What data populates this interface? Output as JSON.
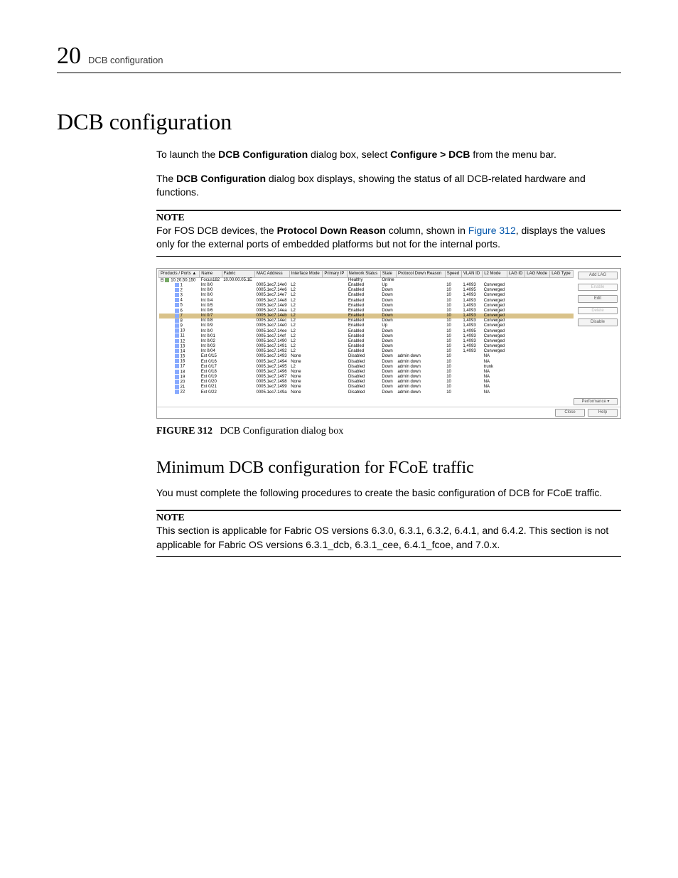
{
  "runningHead": {
    "chapterNumber": "20",
    "chapterLabel": "DCB configuration"
  },
  "title": "DCB configuration",
  "intro": {
    "p1a": "To launch the ",
    "p1b": "DCB Configuration",
    "p1c": " dialog box, select ",
    "p1d": "Configure > DCB",
    "p1e": " from the menu bar.",
    "p2a": "The ",
    "p2b": "DCB Configuration",
    "p2c": " dialog box displays, showing the status of all DCB-related hardware and functions."
  },
  "note1": {
    "heading": "NOTE",
    "a": "For FOS DCB devices, the ",
    "b": "Protocol Down Reason",
    "c": " column, shown in ",
    "link": "Figure 312",
    "d": ", displays the values only for the external ports of embedded platforms but not for the internal ports."
  },
  "figureCaption": {
    "label": "FIGURE 312",
    "text": "DCB Configuration dialog box"
  },
  "subtitle": "Minimum DCB configuration for FCoE traffic",
  "sub_p": "You must complete the following procedures to create the basic configuration of DCB for FCoE traffic.",
  "note2": {
    "heading": "NOTE",
    "text": "This section is applicable for Fabric OS versions 6.3.0, 6.3.1, 6.3.2, 6.4.1, and 6.4.2. This section is not applicable for Fabric OS versions 6.3.1_dcb, 6.3.1_cee, 6.4.1_fcoe, and 7.0.x."
  },
  "screenshot": {
    "buttons": {
      "addLag": "Add LAG",
      "enable": "Enable",
      "edit": "Edit",
      "delete": "Delete",
      "disable": "Disable",
      "performance": "Performance ▾",
      "close": "Close",
      "help": "Help"
    },
    "columns": [
      "Products / Ports ▲",
      "Name",
      "Fabric",
      "MAC Address",
      "Interface Mode",
      "Primary IP",
      "Network Status",
      "State",
      "Protocol Down Reason",
      "Speed",
      "VLAN ID",
      "L2 Mode",
      "LAG ID",
      "LAG Mode",
      "LAG Type"
    ],
    "root": {
      "product": "10.20.50.150",
      "name": "Focus182",
      "fabric": "10.00.00.05.1E",
      "netstatus": "Healthy",
      "state": "Online"
    },
    "rows": [
      {
        "p": "1",
        "name": "Int 0/0",
        "mac": "0005.1ec7.14e0",
        "mode": "L2",
        "ns": "Enabled",
        "st": "Up",
        "sp": "10",
        "vl": "1,4093",
        "l2": "Converged"
      },
      {
        "p": "2",
        "name": "Int 0/0",
        "mac": "0005.1ec7.14e6",
        "mode": "L2",
        "ns": "Enabled",
        "st": "Down",
        "sp": "10",
        "vl": "1,4095",
        "l2": "Converged"
      },
      {
        "p": "3",
        "name": "Int 0/0",
        "mac": "0005.1ec7.14e7",
        "mode": "L2",
        "ns": "Enabled",
        "st": "Down",
        "sp": "10",
        "vl": "1,4093",
        "l2": "Converged"
      },
      {
        "p": "4",
        "name": "Int 0/4",
        "mac": "0005.1ec7.14e8",
        "mode": "L2",
        "ns": "Enabled",
        "st": "Down",
        "sp": "10",
        "vl": "1,4093",
        "l2": "Converged"
      },
      {
        "p": "5",
        "name": "Int 0/5",
        "mac": "0005.1ec7.14e9",
        "mode": "L2",
        "ns": "Enabled",
        "st": "Down",
        "sp": "10",
        "vl": "1,4093",
        "l2": "Converged"
      },
      {
        "p": "6",
        "name": "Int 0/6",
        "mac": "0005.1ec7.14ea",
        "mode": "L2",
        "ns": "Enabled",
        "st": "Down",
        "sp": "10",
        "vl": "1,4093",
        "l2": "Converged"
      },
      {
        "p": "7",
        "name": "Int 0/7",
        "mac": "0005.1ec7.14eb",
        "mode": "L2",
        "ns": "Enabled",
        "st": "Down",
        "sp": "10",
        "vl": "1,4093",
        "l2": "Converged",
        "sel": true
      },
      {
        "p": "8",
        "name": "Int 0/8",
        "mac": "0005.1ec7.14ec",
        "mode": "L2",
        "ns": "Enabled",
        "st": "Down",
        "sp": "10",
        "vl": "1,4093",
        "l2": "Converged"
      },
      {
        "p": "9",
        "name": "Int 0/9",
        "mac": "0005.1ec7.14e0",
        "mode": "L2",
        "ns": "Enabled",
        "st": "Up",
        "sp": "10",
        "vl": "1,4093",
        "l2": "Converged"
      },
      {
        "p": "10",
        "name": "Int 0/0",
        "mac": "0005.1ec7.14ee",
        "mode": "L2",
        "ns": "Enabled",
        "st": "Down",
        "sp": "10",
        "vl": "1,4095",
        "l2": "Converged"
      },
      {
        "p": "11",
        "name": "Int 0/01",
        "mac": "0005.1ec7.14ef",
        "mode": "L2",
        "ns": "Enabled",
        "st": "Down",
        "sp": "10",
        "vl": "1,4093",
        "l2": "Converged"
      },
      {
        "p": "12",
        "name": "Int 0/02",
        "mac": "0005.1ec7.1490",
        "mode": "L2",
        "ns": "Enabled",
        "st": "Down",
        "sp": "10",
        "vl": "1,4093",
        "l2": "Converged"
      },
      {
        "p": "13",
        "name": "Int 0/03",
        "mac": "0005.1ec7.1491",
        "mode": "L2",
        "ns": "Enabled",
        "st": "Down",
        "sp": "10",
        "vl": "1,4093",
        "l2": "Converged"
      },
      {
        "p": "14",
        "name": "Int 0/04",
        "mac": "0005.1ec7.1492",
        "mode": "L2",
        "ns": "Enabled",
        "st": "Down",
        "sp": "10",
        "vl": "1,4093",
        "l2": "Converged"
      },
      {
        "p": "15",
        "name": "Ext 0/15",
        "mac": "0005.1ec7.1493",
        "mode": "None",
        "ns": "Disabled",
        "st": "Down",
        "pdr": "admin down",
        "sp": "10",
        "vl": "",
        "l2": "NA"
      },
      {
        "p": "16",
        "name": "Ext 0/16",
        "mac": "0005.1ec7.1494",
        "mode": "None",
        "ns": "Disabled",
        "st": "Down",
        "pdr": "admin down",
        "sp": "10",
        "vl": "",
        "l2": "NA"
      },
      {
        "p": "17",
        "name": "Ext 0/17",
        "mac": "0005.1ec7.1495",
        "mode": "L2",
        "ns": "Disabled",
        "st": "Down",
        "pdr": "admin down",
        "sp": "10",
        "vl": "",
        "l2": "trunk"
      },
      {
        "p": "18",
        "name": "Ext 0/18",
        "mac": "0005.1ec7.1496",
        "mode": "None",
        "ns": "Disabled",
        "st": "Down",
        "pdr": "admin down",
        "sp": "10",
        "vl": "",
        "l2": "NA"
      },
      {
        "p": "19",
        "name": "Ext 0/19",
        "mac": "0005.1ec7.1497",
        "mode": "None",
        "ns": "Disabled",
        "st": "Down",
        "pdr": "admin down",
        "sp": "10",
        "vl": "",
        "l2": "NA"
      },
      {
        "p": "20",
        "name": "Ext 0/20",
        "mac": "0005.1ec7.1498",
        "mode": "None",
        "ns": "Disabled",
        "st": "Down",
        "pdr": "admin down",
        "sp": "10",
        "vl": "",
        "l2": "NA"
      },
      {
        "p": "21",
        "name": "Ext 0/21",
        "mac": "0005.1ec7.1499",
        "mode": "None",
        "ns": "Disabled",
        "st": "Down",
        "pdr": "admin down",
        "sp": "10",
        "vl": "",
        "l2": "NA"
      },
      {
        "p": "22",
        "name": "Ext 0/22",
        "mac": "0005.1ec7.149a",
        "mode": "None",
        "ns": "Disabled",
        "st": "Down",
        "pdr": "admin down",
        "sp": "10",
        "vl": "",
        "l2": "NA"
      }
    ]
  }
}
